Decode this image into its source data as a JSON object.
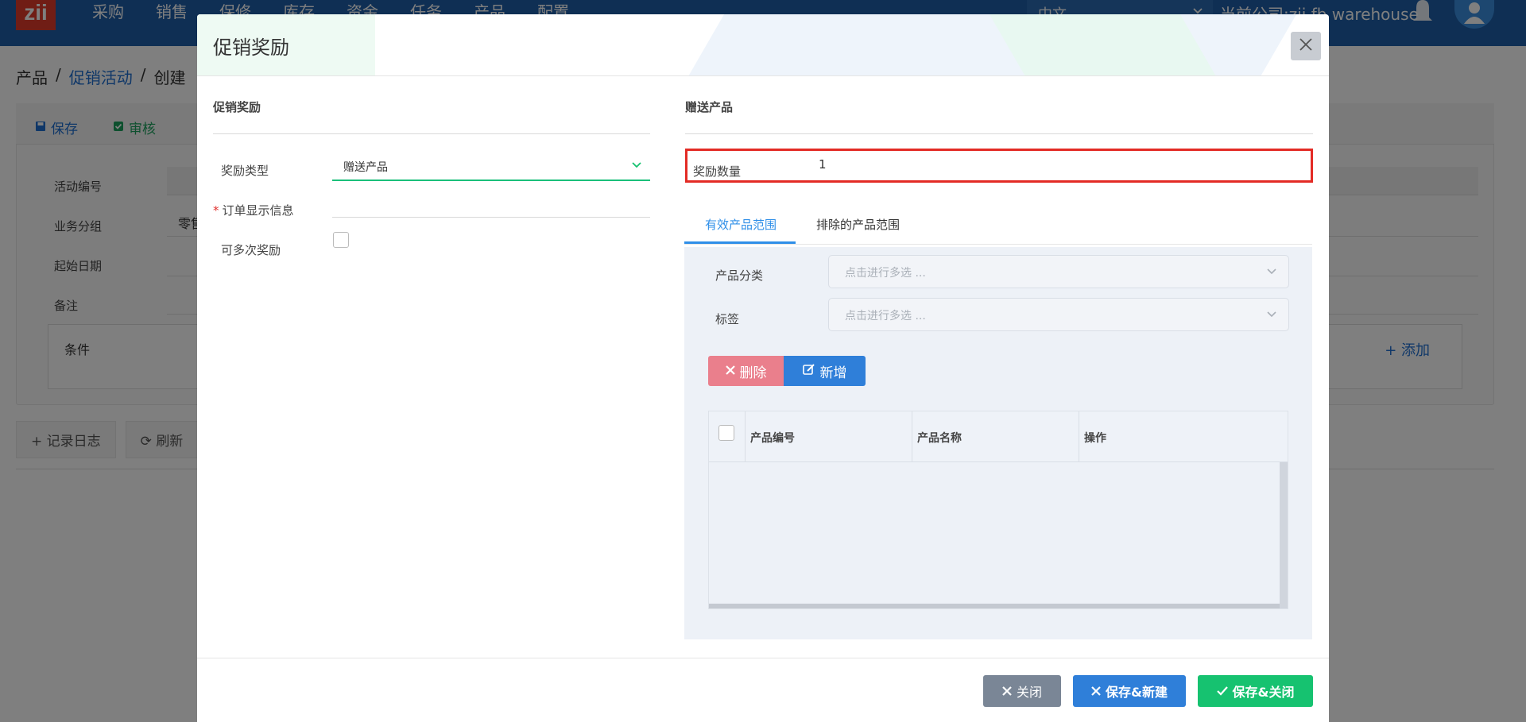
{
  "app": {
    "logo_text": "zii",
    "nav": [
      "采购",
      "销售",
      "保修",
      "库存",
      "资金",
      "任务",
      "产品",
      "配置"
    ],
    "language": "中文",
    "company": "当前公司:zii.fb warehouse"
  },
  "breadcrumb": [
    "产品",
    "促销活动",
    "创建"
  ],
  "page_toolbar": {
    "save": "保存",
    "approve": "审核"
  },
  "page_form": {
    "labels": [
      "活动编号",
      "业务分组",
      "起始日期",
      "备注"
    ],
    "group_value": "零售"
  },
  "conditions": {
    "label": "条件",
    "add": "添加"
  },
  "page_actions": {
    "log": "记录日志",
    "refresh": "刷新"
  },
  "modal": {
    "title": "促销奖励",
    "left_section": "促销奖励",
    "right_section": "赠送产品",
    "reward_type_label": "奖励类型",
    "reward_type_value": "赠送产品",
    "order_info_label": "订单显示信息",
    "repeat_label": "可多次奖励",
    "qty_label": "奖励数量",
    "qty_value": "1",
    "tabs": [
      "有效产品范围",
      "排除的产品范围"
    ],
    "category_label": "产品分类",
    "category_placeholder": "点击进行多选 ...",
    "tag_label": "标签",
    "tag_placeholder": "点击进行多选 ...",
    "delete_btn": "删除",
    "add_btn": "新增",
    "table_columns": [
      "产品编号",
      "产品名称",
      "操作"
    ],
    "footer": {
      "close": "关闭",
      "save_new": "保存&新建",
      "save_close": "保存&关闭"
    }
  },
  "colors": {
    "topbar": "#1e5fa8",
    "accent_green": "#16c270",
    "accent_blue": "#2f7fd9",
    "danger": "#e32b25",
    "delete_pink": "#ea7f8c"
  }
}
